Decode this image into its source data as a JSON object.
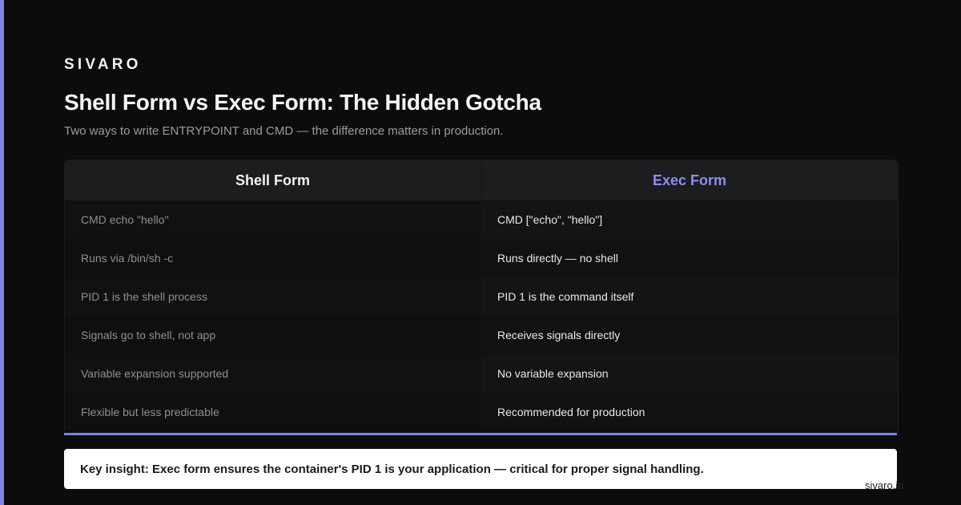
{
  "brand": "SIVARO",
  "title": "Shell Form vs Exec Form: The Hidden Gotcha",
  "subtitle": "Two ways to write ENTRYPOINT and CMD — the difference matters in production.",
  "colors": {
    "accent": "#7f82e8",
    "background": "#0c0c0d",
    "exec_header": "#8b8ef0"
  },
  "table": {
    "headers": [
      "Shell Form",
      "Exec Form"
    ],
    "rows": [
      [
        "CMD echo \"hello\"",
        "CMD [\"echo\", \"hello\"]"
      ],
      [
        "Runs via /bin/sh -c",
        "Runs directly — no shell"
      ],
      [
        "PID 1 is the shell process",
        "PID 1 is the command itself"
      ],
      [
        "Signals go to shell, not app",
        "Receives signals directly"
      ],
      [
        "Variable expansion supported",
        "No variable expansion"
      ],
      [
        "Flexible but less predictable",
        "Recommended for production"
      ]
    ]
  },
  "insight": "Key insight: Exec form ensures the container's PID 1 is your application — critical for proper signal handling.",
  "watermark": "sivaro.in"
}
